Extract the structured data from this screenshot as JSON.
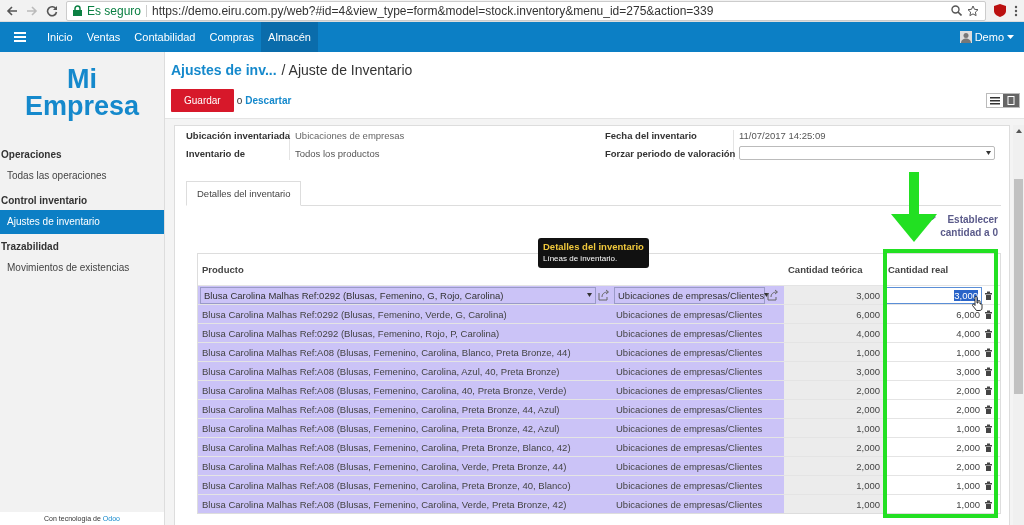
{
  "browser": {
    "secure_label": "Es seguro",
    "url": "https://demo.eiru.com.py/web?#id=4&view_type=form&model=stock.inventory&menu_id=275&action=339"
  },
  "topnav": {
    "items": [
      {
        "label": "Inicio",
        "selected": false
      },
      {
        "label": "Ventas",
        "selected": false
      },
      {
        "label": "Contabilidad",
        "selected": false
      },
      {
        "label": "Compras",
        "selected": false
      },
      {
        "label": "Almacén",
        "selected": true
      }
    ],
    "user": "Demo"
  },
  "sidebar": {
    "logo_lines": [
      "Mi",
      "Empresa"
    ],
    "sections": [
      {
        "title": "Operaciones",
        "items": [
          {
            "label": "Todas las operaciones",
            "selected": false
          }
        ]
      },
      {
        "title": "Control inventario",
        "items": [
          {
            "label": "Ajustes de inventario",
            "selected": true
          }
        ]
      },
      {
        "title": "Trazabilidad",
        "items": [
          {
            "label": "Movimientos de existencias",
            "selected": false
          }
        ]
      }
    ],
    "footer": "Con tecnología de",
    "footer_link": "Odoo"
  },
  "breadcrumb": {
    "parent": "Ajustes de inv...",
    "current": "/ Ajuste de Inventario"
  },
  "actions": {
    "save": "Guardar",
    "or": "o",
    "discard": "Descartar"
  },
  "form": {
    "fields_left": [
      {
        "label": "Ubicación inventariada",
        "value": "Ubicaciones de empresas"
      },
      {
        "label": "Inventario de",
        "value": "Todos los productos"
      }
    ],
    "fields_right": [
      {
        "label": "Fecha del inventario",
        "kind": "text",
        "value": "11/07/2017 14:25:09"
      },
      {
        "label": "Forzar periodo de valoración",
        "kind": "select"
      }
    ]
  },
  "tabs": [
    {
      "label": "Detalles del inventario",
      "selected": true
    }
  ],
  "set_zero_link": "Establecer cantidad a 0",
  "tooltip": {
    "title": "Detalles del inventario",
    "text": "Líneas de inventario."
  },
  "table": {
    "columns": {
      "product": "Producto",
      "theoretical": "Cantidad teórica",
      "real": "Cantidad real"
    },
    "rows": [
      {
        "product": "Blusa Carolina Malhas Ref:0292 (Blusas, Femenino, G, Rojo, Carolina)",
        "location": "Ubicaciones de empresas/Clientes",
        "theoretical": "3,000",
        "real": "3,000",
        "editing": true
      },
      {
        "product": "Blusa Carolina Malhas Ref:0292 (Blusas, Femenino, Verde, G, Carolina)",
        "location": "Ubicaciones de empresas/Clientes",
        "theoretical": "6,000",
        "real": "6,000",
        "editing": false
      },
      {
        "product": "Blusa Carolina Malhas Ref:0292 (Blusas, Femenino, Rojo, P, Carolina)",
        "location": "Ubicaciones de empresas/Clientes",
        "theoretical": "4,000",
        "real": "4,000",
        "editing": false
      },
      {
        "product": "Blusa Carolina Malhas Ref:A08 (Blusas, Femenino, Carolina, Blanco, Preta Bronze, 44)",
        "location": "Ubicaciones de empresas/Clientes",
        "theoretical": "1,000",
        "real": "1,000",
        "editing": false
      },
      {
        "product": "Blusa Carolina Malhas Ref:A08 (Blusas, Femenino, Carolina, Azul, 40, Preta Bronze)",
        "location": "Ubicaciones de empresas/Clientes",
        "theoretical": "3,000",
        "real": "3,000",
        "editing": false
      },
      {
        "product": "Blusa Carolina Malhas Ref:A08 (Blusas, Femenino, Carolina, 40, Preta Bronze, Verde)",
        "location": "Ubicaciones de empresas/Clientes",
        "theoretical": "2,000",
        "real": "2,000",
        "editing": false
      },
      {
        "product": "Blusa Carolina Malhas Ref:A08 (Blusas, Femenino, Carolina, Preta Bronze, 44, Azul)",
        "location": "Ubicaciones de empresas/Clientes",
        "theoretical": "2,000",
        "real": "2,000",
        "editing": false
      },
      {
        "product": "Blusa Carolina Malhas Ref:A08 (Blusas, Femenino, Carolina, Preta Bronze, 42, Azul)",
        "location": "Ubicaciones de empresas/Clientes",
        "theoretical": "1,000",
        "real": "1,000",
        "editing": false
      },
      {
        "product": "Blusa Carolina Malhas Ref:A08 (Blusas, Femenino, Carolina, Preta Bronze, Blanco, 42)",
        "location": "Ubicaciones de empresas/Clientes",
        "theoretical": "2,000",
        "real": "2,000",
        "editing": false
      },
      {
        "product": "Blusa Carolina Malhas Ref:A08 (Blusas, Femenino, Carolina, Verde, Preta Bronze, 44)",
        "location": "Ubicaciones de empresas/Clientes",
        "theoretical": "2,000",
        "real": "2,000",
        "editing": false
      },
      {
        "product": "Blusa Carolina Malhas Ref:A08 (Blusas, Femenino, Carolina, Preta Bronze, 40, Blanco)",
        "location": "Ubicaciones de empresas/Clientes",
        "theoretical": "1,000",
        "real": "1,000",
        "editing": false
      },
      {
        "product": "Blusa Carolina Malhas Ref:A08 (Blusas, Femenino, Carolina, Verde, Preta Bronze, 42)",
        "location": "Ubicaciones de empresas/Clientes",
        "theoretical": "1,000",
        "real": "1,000",
        "editing": false
      }
    ]
  }
}
